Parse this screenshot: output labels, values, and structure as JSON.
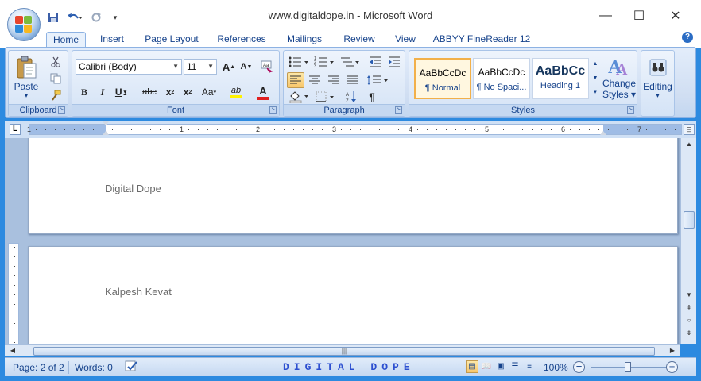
{
  "window": {
    "title": "www.digitaldope.in - Microsoft Word",
    "minimize": "—",
    "maximize": "☐",
    "close": "✕"
  },
  "ribbon_tabs": [
    "Home",
    "Insert",
    "Page Layout",
    "References",
    "Mailings",
    "Review",
    "View",
    "ABBYY FineReader 12"
  ],
  "clipboard": {
    "group_label": "Clipboard",
    "paste_label": "Paste"
  },
  "font": {
    "group_label": "Font",
    "font_name": "Calibri (Body)",
    "font_size": "11",
    "grow": "A",
    "shrink": "A",
    "bold": "B",
    "italic": "I",
    "underline": "U",
    "strikethrough": "abc",
    "subscript": "x",
    "superscript": "x",
    "change_case": "Aa",
    "highlight": "ab",
    "font_color": "A"
  },
  "paragraph": {
    "group_label": "Paragraph",
    "show_marks": "¶"
  },
  "styles": {
    "group_label": "Styles",
    "items": [
      {
        "sample": "AaBbCcDc",
        "name": "¶ Normal"
      },
      {
        "sample": "AaBbCcDc",
        "name": "¶ No Spaci..."
      },
      {
        "sample": "AaBbCc",
        "name": "Heading 1"
      }
    ],
    "change_styles_line1": "Change",
    "change_styles_line2": "Styles"
  },
  "editing": {
    "label": "Editing"
  },
  "ruler": {
    "numbers": [
      "1",
      "1",
      "2",
      "3",
      "4",
      "5",
      "6",
      "7"
    ]
  },
  "document": {
    "page1_text": "Digital Dope",
    "page2_text": "Kalpesh Kevat"
  },
  "status": {
    "page": "Page: 2 of 2",
    "words": "Words: 0",
    "brand": "DIGITAL DOPE",
    "zoom": "100%"
  }
}
